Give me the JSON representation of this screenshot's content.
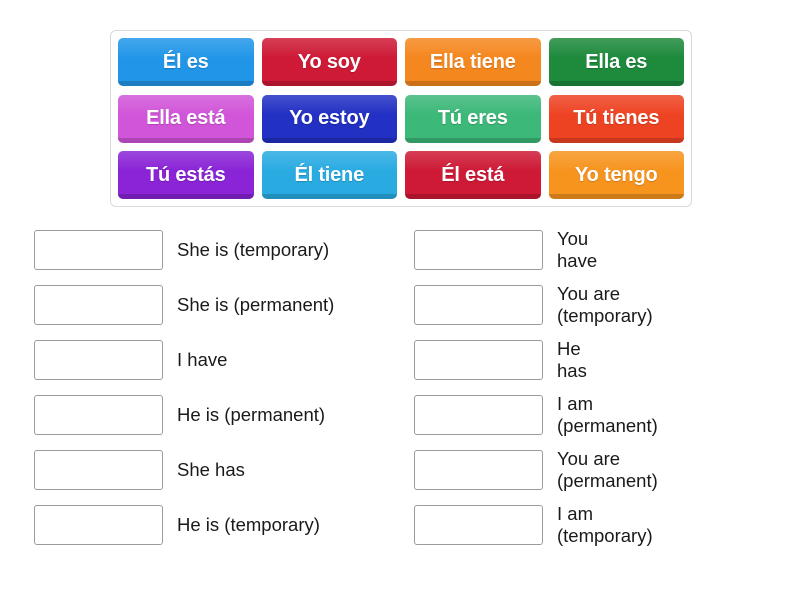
{
  "activity": {
    "type": "match-up",
    "tray": {
      "rows": [
        [
          {
            "label": "Él es",
            "color": "#2196E8"
          },
          {
            "label": "Yo soy",
            "color": "#CE1A36"
          },
          {
            "label": "Ella tiene",
            "color": "#F5871F"
          },
          {
            "label": "Ella es",
            "color": "#1E8A3C"
          }
        ],
        [
          {
            "label": "Ella está",
            "color": "#D155D8"
          },
          {
            "label": "Yo estoy",
            "color": "#2230C4"
          },
          {
            "label": "Tú eres",
            "color": "#3CB878"
          },
          {
            "label": "Tú tienes",
            "color": "#EE4323"
          }
        ],
        [
          {
            "label": "Tú estás",
            "color": "#8A24D6"
          },
          {
            "label": "Él tiene",
            "color": "#29ABE2"
          },
          {
            "label": "Él está",
            "color": "#CE1A36"
          },
          {
            "label": "Yo tengo",
            "color": "#F7941E"
          }
        ]
      ]
    },
    "answers": {
      "left": [
        {
          "label": "She is (temporary)",
          "value": ""
        },
        {
          "label": "She is (permanent)",
          "value": ""
        },
        {
          "label": "I have",
          "value": ""
        },
        {
          "label": "He is (permanent)",
          "value": ""
        },
        {
          "label": "She has",
          "value": ""
        },
        {
          "label": "He is (temporary)",
          "value": ""
        }
      ],
      "right": [
        {
          "label": "You have",
          "value": ""
        },
        {
          "label": "You are (temporary)",
          "value": ""
        },
        {
          "label": "He has",
          "value": ""
        },
        {
          "label": "I am (permanent)",
          "value": ""
        },
        {
          "label": "You are (permanent)",
          "value": ""
        },
        {
          "label": "I am (temporary)",
          "value": ""
        }
      ]
    }
  }
}
